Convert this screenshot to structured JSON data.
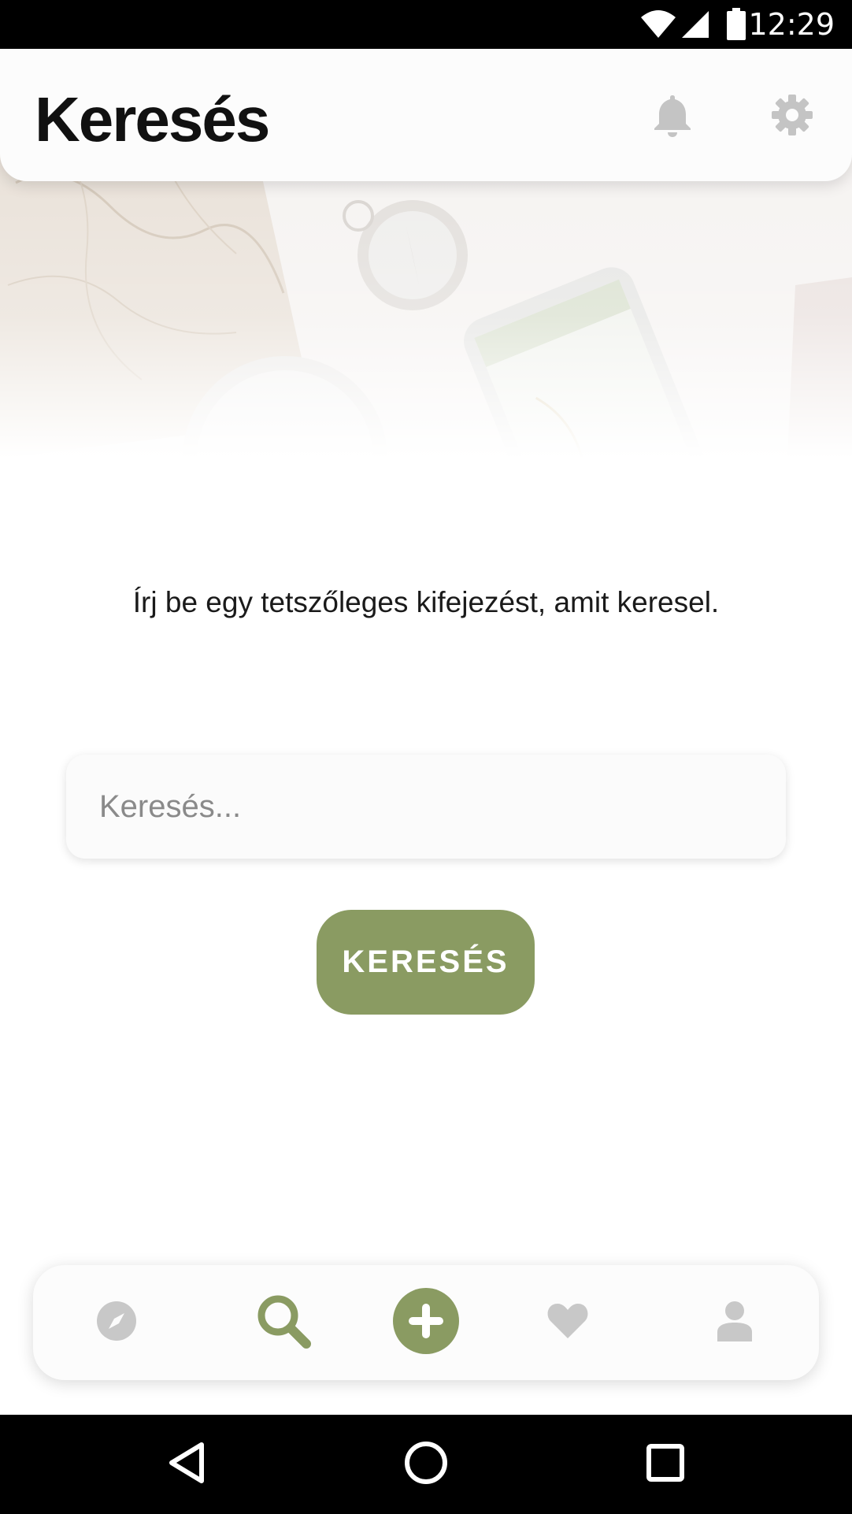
{
  "status_bar": {
    "time": "12:29",
    "icons": [
      "wifi-icon",
      "cellular-signal-icon",
      "battery-icon"
    ]
  },
  "header": {
    "title": "Keresés",
    "actions": [
      "bell-icon",
      "gear-icon"
    ]
  },
  "main": {
    "prompt": "Írj be egy tetszőleges kifejezést, amit keresel.",
    "search_input": {
      "value": "",
      "placeholder": "Keresés..."
    },
    "search_button_label": "KERESÉS"
  },
  "bottom_nav": {
    "items": [
      {
        "icon": "compass-icon",
        "active": false
      },
      {
        "icon": "search-icon",
        "active": true
      },
      {
        "icon": "plus-circle-icon",
        "active": false
      },
      {
        "icon": "heart-icon",
        "active": false
      },
      {
        "icon": "user-icon",
        "active": false
      }
    ]
  },
  "system_nav": {
    "buttons": [
      "back-icon",
      "home-icon",
      "recents-icon"
    ]
  },
  "colors": {
    "accent": "#8a9b62",
    "inactive_icon": "#c8c8c8",
    "header_icon": "#c4c4c4",
    "title_text": "#111111",
    "background": "#ffffff"
  }
}
